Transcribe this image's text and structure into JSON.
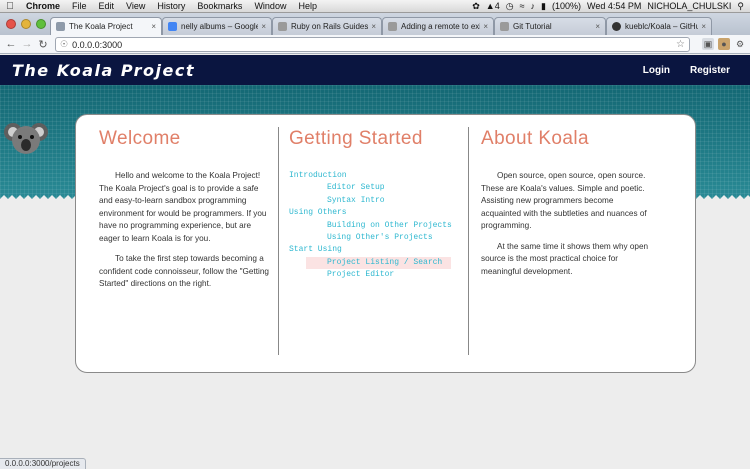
{
  "mac_menu": {
    "app": "Chrome",
    "items": [
      "File",
      "Edit",
      "View",
      "History",
      "Bookmarks",
      "Window",
      "Help"
    ],
    "status_right": {
      "signal": "4",
      "battery": "(100%)",
      "clock": "Wed 4:54 PM",
      "user": "NICHOLA_CHULSKI"
    }
  },
  "tabs": [
    {
      "label": "The Koala Project",
      "active": true,
      "favicon_color": "#8e9aa9"
    },
    {
      "label": "nelly albums – Google Search",
      "active": false,
      "favicon_color": "#4285f4"
    },
    {
      "label": "Ruby on Rails Guides: Rails",
      "active": false,
      "favicon_color": "#9a9a9a"
    },
    {
      "label": "Adding a remote to existing",
      "active": false,
      "favicon_color": "#9a9a9a"
    },
    {
      "label": "Git Tutorial",
      "active": false,
      "favicon_color": "#9a9a9a"
    },
    {
      "label": "kueblc/Koala – GitHub",
      "active": false,
      "favicon_color": "#333333"
    }
  ],
  "toolbar": {
    "url": "0.0.0.0:3000"
  },
  "site": {
    "title": "The Koala Project",
    "nav": {
      "login": "Login",
      "register": "Register"
    }
  },
  "welcome": {
    "heading": "Welcome",
    "p1": "Hello and welcome to the Koala Project! The Koala Project's goal is to provide a safe and easy-to-learn sandbox programming environment for would be programmers. If you have no programming experience, but are eager to learn Koala is for you.",
    "p2": "To take the first step towards becoming a confident code connoisseur, follow the \"Getting Started\" directions on the right."
  },
  "getting_started": {
    "heading": "Getting Started",
    "items": [
      {
        "label": "Introduction",
        "level": 0
      },
      {
        "label": "Editor Setup",
        "level": 1
      },
      {
        "label": "Syntax Intro",
        "level": 1
      },
      {
        "label": "Using Others",
        "level": 0
      },
      {
        "label": "Building on Other Projects",
        "level": 1
      },
      {
        "label": "Using Other's Projects",
        "level": 1
      },
      {
        "label": "Start Using",
        "level": 0
      },
      {
        "label": "Project Listing / Search",
        "level": 1,
        "highlighted": true
      },
      {
        "label": "Project Editor",
        "level": 1
      }
    ]
  },
  "about": {
    "heading": "About Koala",
    "p1": "Open source, open source, open source. These are Koala's values. Simple and poetic. Assisting new programmers become acquainted with the subtleties and nuances of programming.",
    "p2": "At the same time it shows them why open source is the most practical choice for meaningful development."
  },
  "status_bar": "0.0.0.0:3000/projects",
  "colors": {
    "header_bg": "#0a1540",
    "teal": "#176f7a",
    "heading": "#e07f68",
    "link": "#2fb8d0",
    "highlight": "#fbe3e3"
  }
}
